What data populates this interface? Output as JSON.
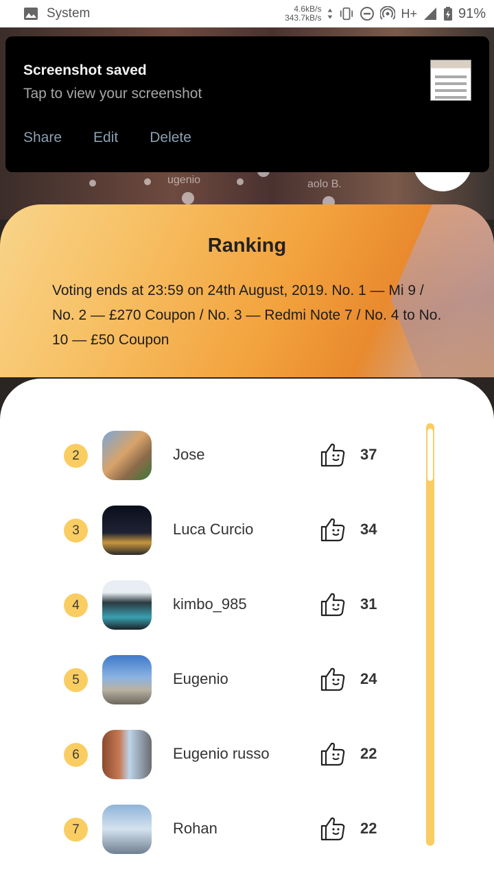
{
  "status_bar": {
    "app_name": "System",
    "net_up": "4.6kB/s",
    "net_down": "343.7kB/s",
    "network_type": "H+",
    "battery": "91%"
  },
  "notification": {
    "title": "Screenshot saved",
    "subtitle": "Tap to view your screenshot",
    "actions": [
      "Share",
      "Edit",
      "Delete"
    ]
  },
  "background": {
    "texts": [
      "ugenio",
      "aolo B."
    ]
  },
  "ranking": {
    "title": "Ranking",
    "description": "Voting ends at 23:59 on 24th August, 2019. No. 1 — Mi 9 / No. 2 — £270 Coupon / No. 3 — Redmi Note 7 / No. 4 to No. 10 — £50 Coupon"
  },
  "list": [
    {
      "rank": "2",
      "name": "Jose",
      "votes": "37"
    },
    {
      "rank": "3",
      "name": "Luca Curcio",
      "votes": "34"
    },
    {
      "rank": "4",
      "name": "kimbo_985",
      "votes": "31"
    },
    {
      "rank": "5",
      "name": "Eugenio",
      "votes": "24"
    },
    {
      "rank": "6",
      "name": "Eugenio russo",
      "votes": "22"
    },
    {
      "rank": "7",
      "name": "Rohan",
      "votes": "22"
    }
  ],
  "colors": {
    "accent": "#f9cd62",
    "notification_bg": "#000000",
    "action_text": "#8aa0b2"
  }
}
